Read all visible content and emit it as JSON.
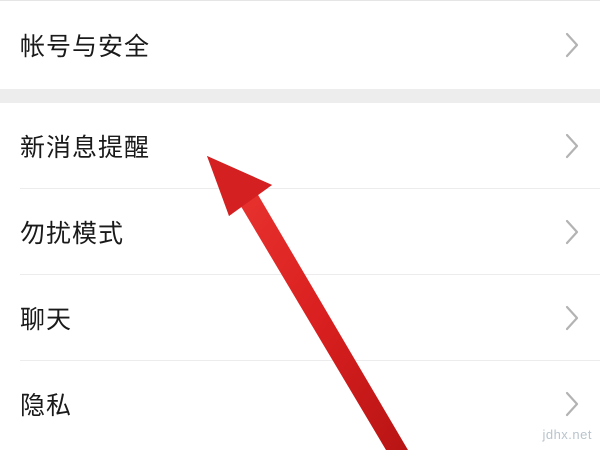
{
  "settings": {
    "items": [
      {
        "label": "帐号与安全"
      },
      {
        "label": "新消息提醒"
      },
      {
        "label": "勿扰模式"
      },
      {
        "label": "聊天"
      },
      {
        "label": "隐私"
      }
    ]
  },
  "overlay": {
    "arrow_color": "#d91f1f",
    "watermark": "jdhx.net"
  },
  "icons": {
    "chevron": "chevron-right-icon"
  }
}
